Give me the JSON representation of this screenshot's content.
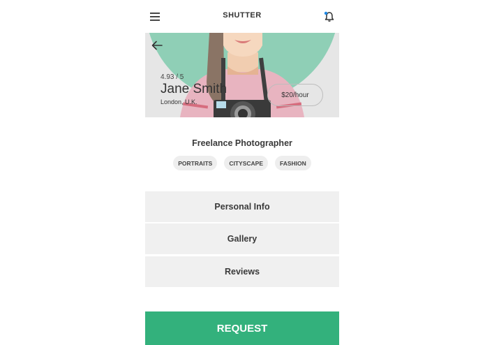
{
  "app": {
    "title": "SHUTTER"
  },
  "icons": {
    "menu": "hamburger-menu-icon",
    "notifications": "bell-icon",
    "back": "arrow-left-icon"
  },
  "profile": {
    "rating": "4.93 / 5",
    "name": "Jane Smith",
    "location": "London, U.K.",
    "rate": "$20/hour",
    "title": "Freelance Photographer",
    "tags": [
      "PORTRAITS",
      "CITYSCAPE",
      "FASHION"
    ]
  },
  "sections": [
    "Personal Info",
    "Gallery",
    "Reviews"
  ],
  "action": {
    "request_label": "REQUEST"
  },
  "colors": {
    "accent": "#33b17c",
    "hero_circle": "#8fcfb6",
    "shirt": "#e8b4c0",
    "notification_dot": "#1e88e5"
  }
}
